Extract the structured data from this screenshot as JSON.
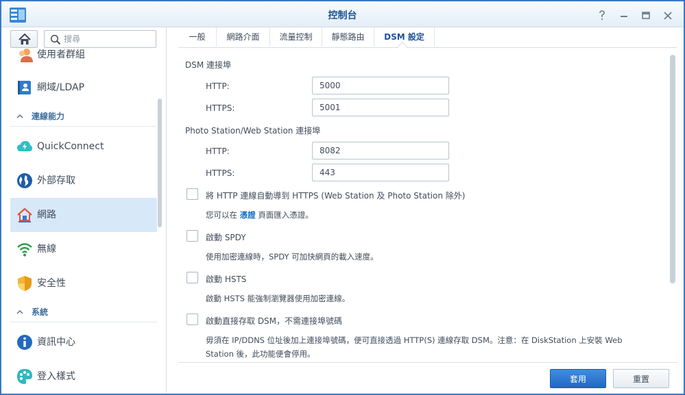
{
  "window": {
    "title": "控制台",
    "controls": [
      "help-icon",
      "minimize-icon",
      "maximize-icon",
      "close-icon"
    ]
  },
  "sidebar": {
    "search_placeholder": "搜尋",
    "items": [
      {
        "label": "使用者群組",
        "icon": "user-group-icon"
      },
      {
        "label": "網域/LDAP",
        "icon": "domain-ldap-icon"
      },
      {
        "section": "連線能力"
      },
      {
        "label": "QuickConnect",
        "icon": "quickconnect-icon"
      },
      {
        "label": "外部存取",
        "icon": "external-access-icon"
      },
      {
        "label": "網路",
        "icon": "network-icon",
        "active": true
      },
      {
        "label": "無線",
        "icon": "wireless-icon"
      },
      {
        "label": "安全性",
        "icon": "security-icon"
      },
      {
        "section": "系統"
      },
      {
        "label": "資訊中心",
        "icon": "info-center-icon"
      },
      {
        "label": "登入樣式",
        "icon": "login-style-icon"
      }
    ]
  },
  "tabs": [
    {
      "label": "一般"
    },
    {
      "label": "網路介面"
    },
    {
      "label": "流量控制"
    },
    {
      "label": "靜態路由"
    },
    {
      "label": "DSM 設定",
      "active": true
    }
  ],
  "content": {
    "dsm_port_title": "DSM 連接埠",
    "http_label": "HTTP:",
    "https_label": "HTTPS:",
    "dsm_http": "5000",
    "dsm_https": "5001",
    "photo_web_title": "Photo Station/Web Station 連接埠",
    "pw_http": "8082",
    "pw_https": "443",
    "redirect_label": "將 HTTP 連線自動導到 HTTPS (Web Station 及 Photo Station 除外)",
    "redirect_desc_pre": "您可以在",
    "redirect_desc_link": "憑證",
    "redirect_desc_post": "頁面匯入憑證。",
    "spdy_label": "啟動 SPDY",
    "spdy_desc": "使用加密連線時，SPDY 可加快網頁的載入速度。",
    "hsts_label": "啟動 HSTS",
    "hsts_desc": "啟動 HSTS 能強制瀏覽器使用加密連線。",
    "direct_label": "啟動直接存取 DSM，不需連接埠號碼",
    "direct_desc_1": "毋須在 IP/DDNS 位址後加上連接埠號碼，便可直接透過 HTTP(S) 連線存取 DSM。注意：在 DiskStation 上安裝 Web",
    "direct_desc_2": "Station 後，此功能便會停用。"
  },
  "footer": {
    "apply_label": "套用",
    "reset_label": "重置"
  },
  "colors": {
    "accent": "#1e5496",
    "primary_button": "#2a78d2",
    "active_item_bg": "#d7e8f8"
  }
}
